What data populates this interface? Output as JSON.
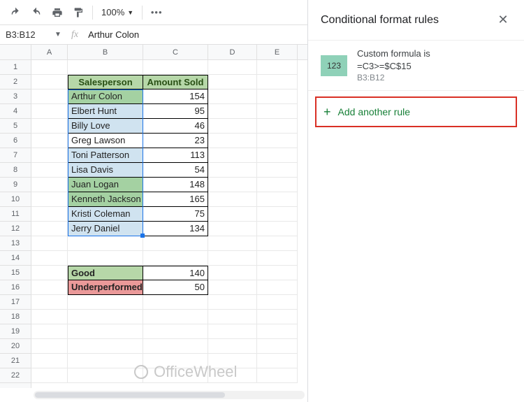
{
  "toolbar": {
    "zoom": "100%"
  },
  "namebox": "B3:B12",
  "formula": "Arthur Colon",
  "cols": {
    "A": 52,
    "B": 108,
    "C": 93,
    "D": 70,
    "E": 58
  },
  "headers": {
    "b": "Salesperson",
    "c": "Amount Sold"
  },
  "rows": [
    {
      "name": "Arthur Colon",
      "amt": "154",
      "hl": 2
    },
    {
      "name": "Elbert Hunt",
      "amt": "95",
      "hl": 1
    },
    {
      "name": "Billy Love",
      "amt": "46",
      "hl": 1
    },
    {
      "name": "Greg Lawson",
      "amt": "23",
      "hl": 0
    },
    {
      "name": "Toni Patterson",
      "amt": "113",
      "hl": 1
    },
    {
      "name": "Lisa Davis",
      "amt": "54",
      "hl": 1
    },
    {
      "name": "Juan Logan",
      "amt": "148",
      "hl": 2
    },
    {
      "name": "Kenneth Jackson",
      "amt": "165",
      "hl": 2
    },
    {
      "name": "Kristi Coleman",
      "amt": "75",
      "hl": 1
    },
    {
      "name": "Jerry Daniel",
      "amt": "134",
      "hl": 1
    }
  ],
  "summary": [
    {
      "label": "Good",
      "val": "140",
      "cls": "good"
    },
    {
      "label": "Underperformed",
      "val": "50",
      "cls": "under"
    }
  ],
  "panel": {
    "title": "Conditional format rules",
    "swatch": "123",
    "rule_label": "Custom formula is",
    "rule_formula": "=C3>=$C$15",
    "rule_range": "B3:B12",
    "add": "Add another rule"
  },
  "watermark": "OfficeWheel"
}
